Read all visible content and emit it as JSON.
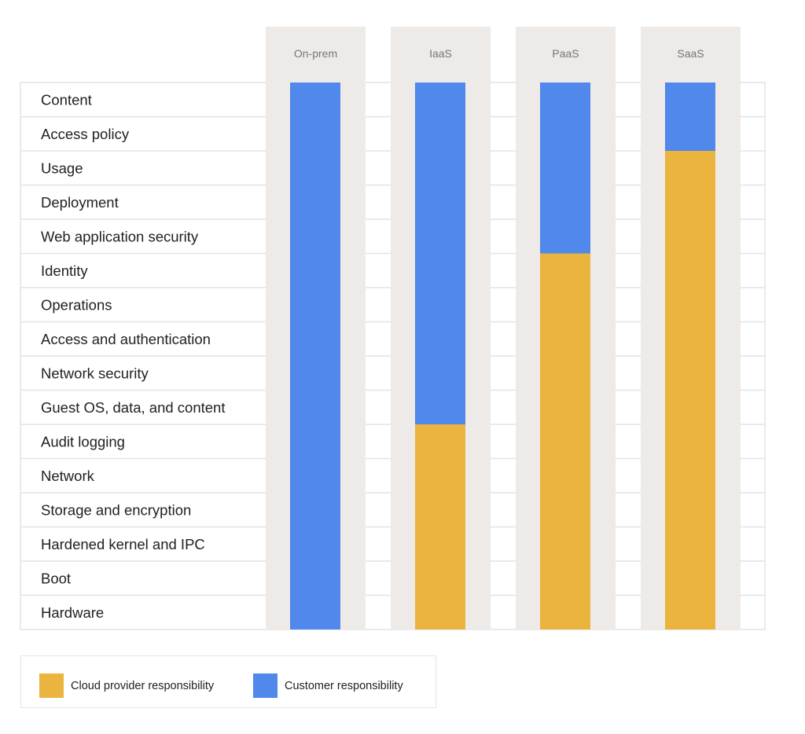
{
  "chart_data": {
    "type": "table",
    "title": "",
    "columns": [
      "On-prem",
      "IaaS",
      "PaaS",
      "SaaS"
    ],
    "rows": [
      "Content",
      "Access policy",
      "Usage",
      "Deployment",
      "Web application security",
      "Identity",
      "Operations",
      "Access and authentication",
      "Network security",
      "Guest OS, data, and content",
      "Audit logging",
      "Network",
      "Storage and encryption",
      "Hardened kernel and IPC",
      "Boot",
      "Hardware"
    ],
    "series": [
      {
        "name": "Customer responsibility",
        "color": "#5088eb",
        "rows_per_column": {
          "On-prem": 16,
          "IaaS": 10,
          "PaaS": 5,
          "SaaS": 2
        }
      },
      {
        "name": "Cloud provider responsibility",
        "color": "#eab43f",
        "rows_per_column": {
          "On-prem": 0,
          "IaaS": 6,
          "PaaS": 11,
          "SaaS": 14
        }
      }
    ],
    "customer_rows_from_top": [
      16,
      10,
      5,
      2
    ],
    "legend": [
      {
        "label": "Cloud provider responsibility",
        "color": "#eab43f"
      },
      {
        "label": "Customer responsibility",
        "color": "#5088eb"
      }
    ],
    "legend_position": "bottom-left"
  },
  "colors": {
    "customer": "#5088eb",
    "provider": "#eab43f",
    "column_bg": "#eeeae7",
    "grid": "#e4e4e4"
  }
}
